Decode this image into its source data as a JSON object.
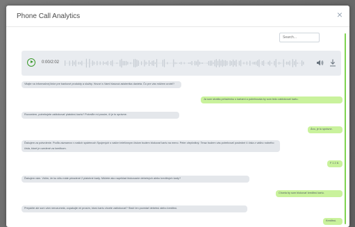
{
  "modal": {
    "title": "Phone Call Analytics",
    "close_glyph": "×"
  },
  "search": {
    "placeholder": "Search..."
  },
  "player": {
    "time": "0:00/2:02",
    "play_icon": "play-circle-icon",
    "volume_icon": "volume-icon",
    "download_icon": "download-icon",
    "accent": "#3b9a2a"
  },
  "colors": {
    "agent_bubble": "#e4e7eb",
    "caller_bubble": "#c9f29c",
    "scrollbar": "#7fd34f"
  },
  "messages": [
    {
      "speaker": "agent",
      "text": "Vitajte na informačnej linke pre bankové produkty a služby. Hovorí s Vami hlasová asistentka danieta. Čo pre vás môžem urobiť?"
    },
    {
      "speaker": "caller",
      "text": "Ja som stratila peňaženku s kartami a potrebovala by som tedo zablokovať kartu."
    },
    {
      "speaker": "agent",
      "text": "Rozumiem, potrebujete zablokovať platobnú kartu? Potvrďte mi prosím, či je to správne."
    },
    {
      "speaker": "caller",
      "text": "Áno, je to správne."
    },
    {
      "speaker": "agent",
      "text": "Ďakujem za potvrdenie. Podľa záznamov v našich systémoch Spojených s vaším telefónnym číslom budem blokovať kartu na meno. Peter zlepšnišný. Teraz budem vás potrebovať posledné 4 čísla z vášho rodného čísla, ktoré je uvedené za lomítkom."
    },
    {
      "speaker": "caller",
      "text": "F 1 2 8."
    },
    {
      "speaker": "agent",
      "text": "Ďakujem vám. Vidím, že ku účtu máte priradené 2 platobné karty. Môžete ako napríklad blokovanie debetných alebo kreditných karty?"
    },
    {
      "speaker": "caller",
      "text": "Chcela by som blokovať kreditnú kartu."
    },
    {
      "speaker": "agent",
      "text": "Prepáčte ale som vám nerozumela, zopakujte mi prosím, ktorú kartu chcete zablokovať? Stačí len povedať debetnú alebo kreditnú."
    },
    {
      "speaker": "caller",
      "text": "Kreditnú."
    }
  ]
}
